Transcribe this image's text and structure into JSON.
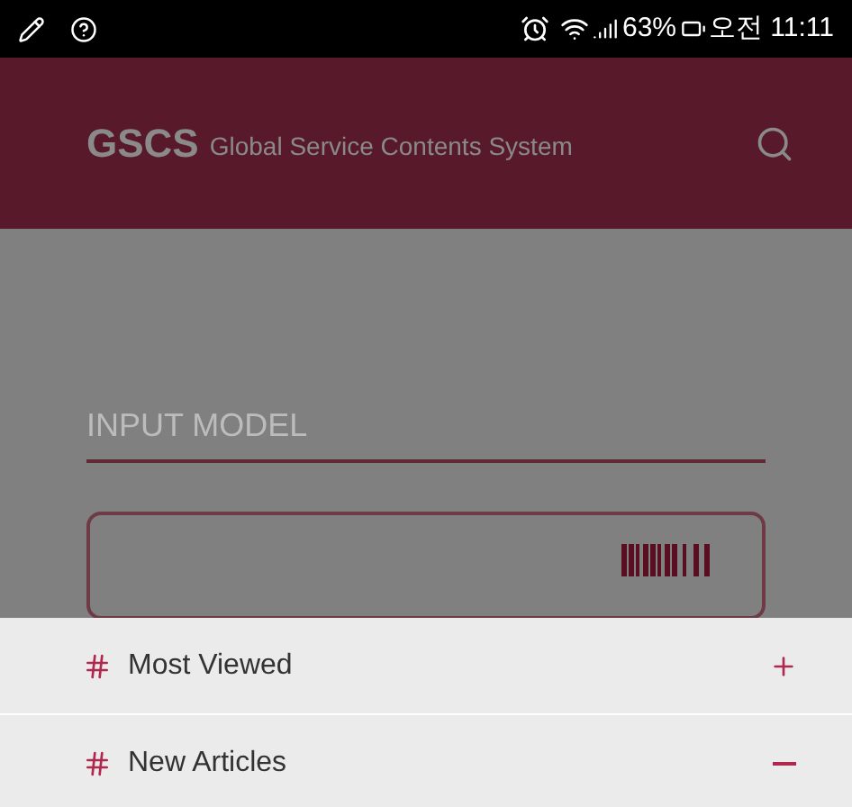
{
  "status_bar": {
    "battery": "63%",
    "time": "오전 11:11"
  },
  "header": {
    "logo": "GSCS",
    "subtitle": "Global Service Contents System"
  },
  "model_field": {
    "placeholder": "INPUT MODEL"
  },
  "sections": [
    {
      "label": "Most Viewed",
      "expanded": false
    },
    {
      "label": "New Articles",
      "expanded": true
    }
  ]
}
